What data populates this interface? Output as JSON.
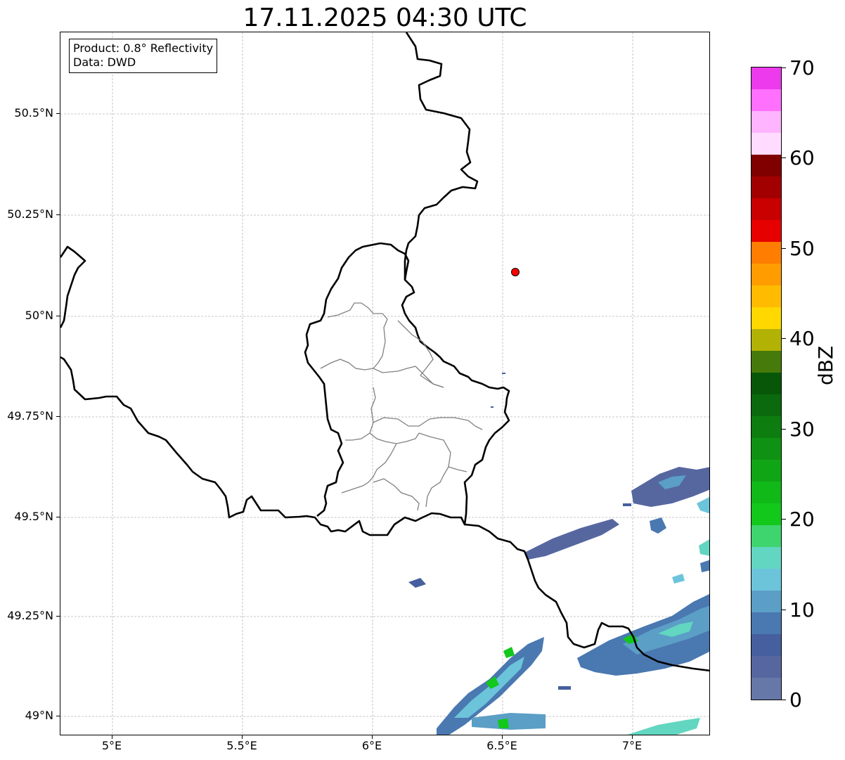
{
  "title": "17.11.2025 04:30 UTC",
  "info_box": {
    "product_line": "Product: 0.8° Reflectivity",
    "data_line": "Data: DWD"
  },
  "axes": {
    "x_ticks": [
      "5°E",
      "5.5°E",
      "6°E",
      "6.5°E",
      "7°E"
    ],
    "y_ticks": [
      "50.5°N",
      "50.25°N",
      "50°N",
      "49.75°N",
      "49.5°N",
      "49.25°N",
      "49°N"
    ],
    "grid": true
  },
  "colorbar": {
    "label": "dBZ",
    "tick_labels": [
      "0",
      "10",
      "20",
      "30",
      "40",
      "50",
      "60",
      "70"
    ],
    "colors": [
      "#6678a8",
      "#5667a0",
      "#465f9e",
      "#4a78b0",
      "#5b9ec6",
      "#6cc4db",
      "#62d6c0",
      "#3ed46e",
      "#12c81a",
      "#10b918",
      "#10a515",
      "#0f9213",
      "#0d7d10",
      "#0b690e",
      "#085708",
      "#467a0a",
      "#b2b205",
      "#ffd800",
      "#ffbb00",
      "#ff9d00",
      "#ff7d00",
      "#e60000",
      "#c80000",
      "#a20000",
      "#800000",
      "#ffdcff",
      "#ffb4ff",
      "#ff70ff",
      "#ec3aec"
    ]
  },
  "map": {
    "background": "#ffffff",
    "border_color": "#000000",
    "region_color": "#808080",
    "marker": {
      "label": "radar-site",
      "color": "#ff0000"
    }
  }
}
